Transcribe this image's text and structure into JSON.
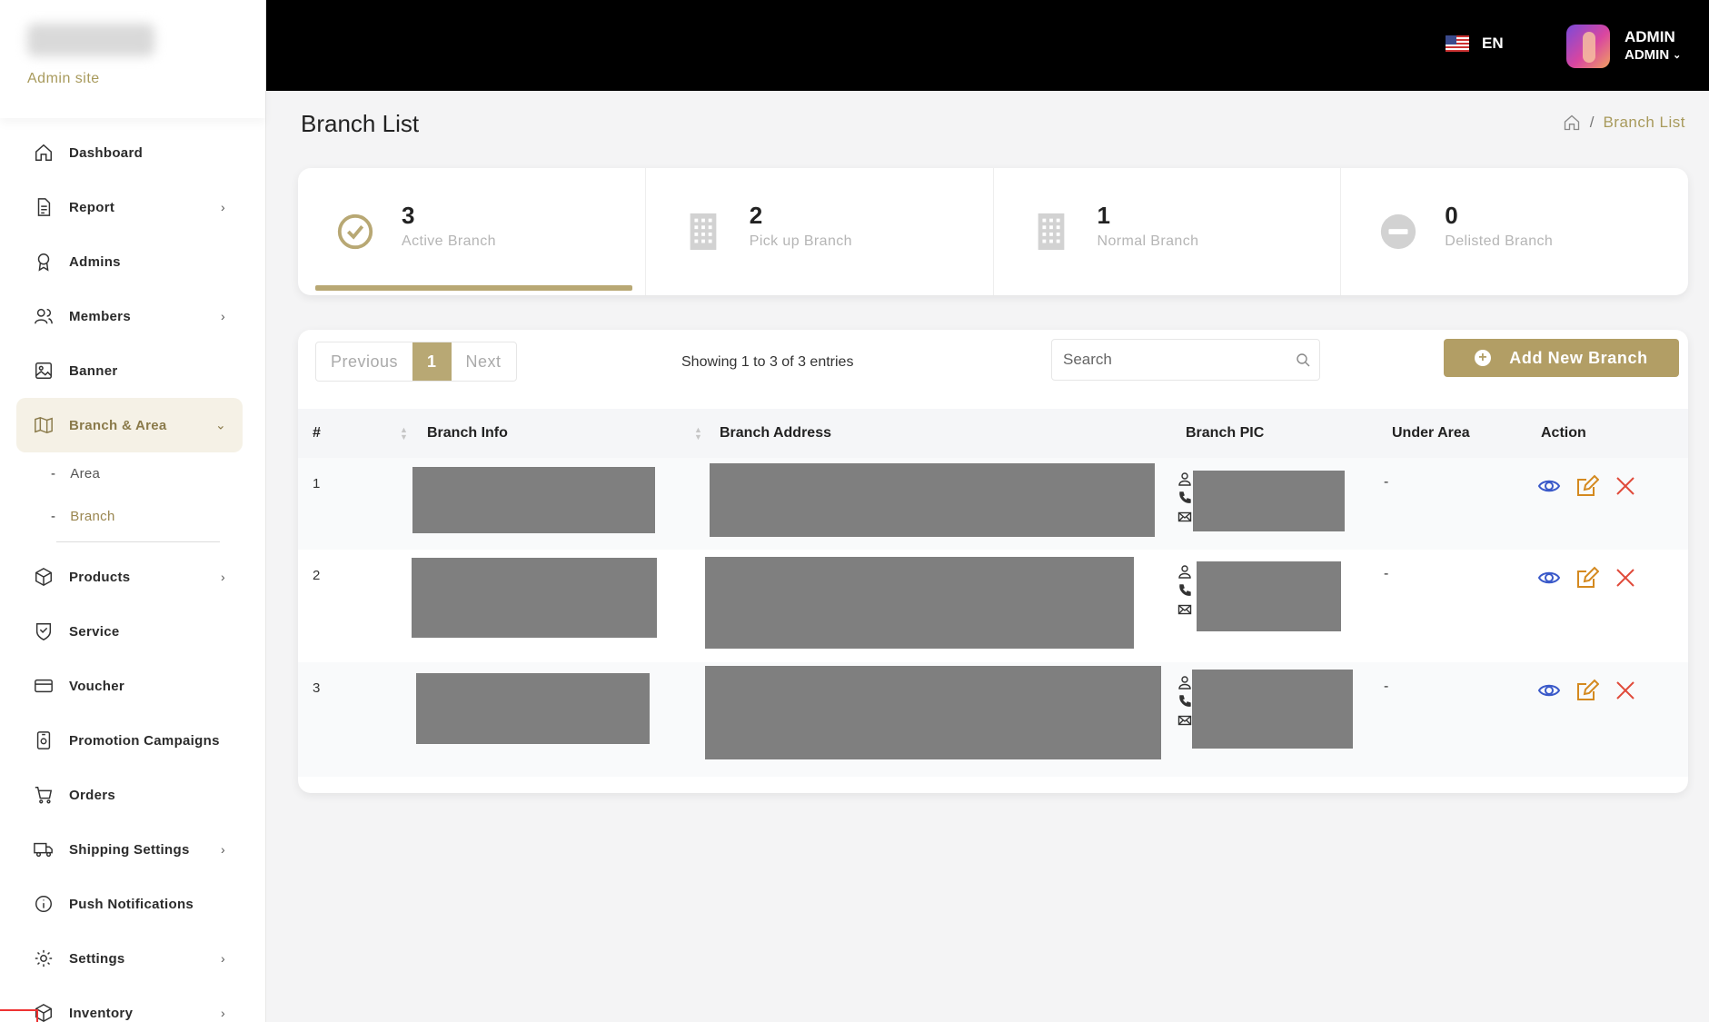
{
  "sidebar": {
    "subtitle": "Admin site",
    "items": [
      {
        "label": "Dashboard",
        "icon": "home-icon"
      },
      {
        "label": "Report",
        "icon": "document-icon",
        "has_children": true
      },
      {
        "label": "Admins",
        "icon": "badge-icon"
      },
      {
        "label": "Members",
        "icon": "users-icon",
        "has_children": true
      },
      {
        "label": "Banner",
        "icon": "image-icon"
      },
      {
        "label": "Branch & Area",
        "icon": "map-icon",
        "expanded": true
      },
      {
        "label": "Products",
        "icon": "box-icon",
        "has_children": true
      },
      {
        "label": "Service",
        "icon": "shield-heart-icon"
      },
      {
        "label": "Voucher",
        "icon": "card-icon"
      },
      {
        "label": "Promotion Campaigns",
        "icon": "campaign-icon"
      },
      {
        "label": "Orders",
        "icon": "cart-icon"
      },
      {
        "label": "Shipping Settings",
        "icon": "truck-icon",
        "has_children": true
      },
      {
        "label": "Push Notifications",
        "icon": "info-icon"
      },
      {
        "label": "Settings",
        "icon": "gear-icon",
        "has_children": true
      },
      {
        "label": "Inventory",
        "icon": "inventory-box-icon",
        "has_children": true
      }
    ],
    "subitems": [
      {
        "label": "Area"
      },
      {
        "label": "Branch",
        "current": true
      }
    ]
  },
  "topbar": {
    "language": "EN",
    "user_name": "ADMIN",
    "user_role": "ADMIN"
  },
  "header": {
    "title": "Branch List",
    "breadcrumb_current": "Branch List"
  },
  "stats": [
    {
      "value": "3",
      "label": "Active Branch",
      "icon": "check-circle-icon",
      "selected": true
    },
    {
      "value": "2",
      "label": "Pick up Branch",
      "icon": "building-icon"
    },
    {
      "value": "1",
      "label": "Normal Branch",
      "icon": "building-icon"
    },
    {
      "value": "0",
      "label": "Delisted Branch",
      "icon": "minus-circle-icon"
    }
  ],
  "pagination": {
    "previous": "Previous",
    "current": "1",
    "next": "Next"
  },
  "showing_text": "Showing 1 to 3 of 3 entries",
  "search": {
    "placeholder": "Search"
  },
  "add_button": "Add New Branch",
  "table": {
    "columns": [
      "#",
      "Branch Info",
      "Branch Address",
      "Branch PIC",
      "Under Area",
      "Action"
    ],
    "rows": [
      {
        "no": "1",
        "under_area": "-"
      },
      {
        "no": "2",
        "under_area": "-"
      },
      {
        "no": "3",
        "under_area": "-"
      }
    ]
  },
  "colors": {
    "accent": "#b29e65",
    "view": "#3a59c9",
    "edit": "#d4891f",
    "delete": "#e04a3a"
  }
}
